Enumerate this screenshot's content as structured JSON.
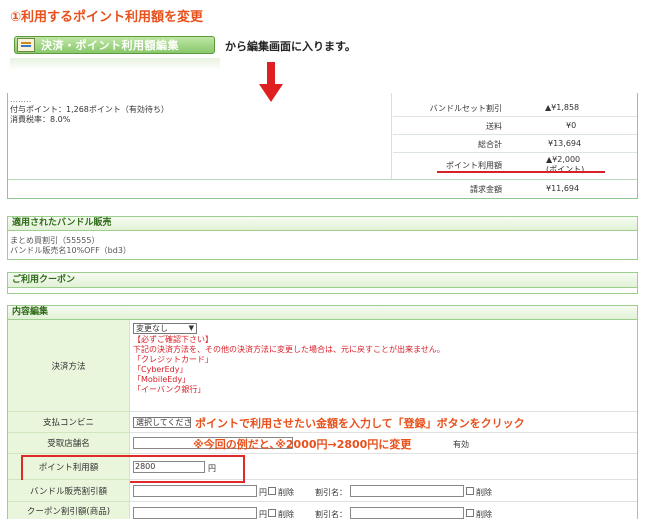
{
  "instructions": {
    "step_title": "①利用するポイント利用額を変更",
    "edit_button_label": "決済・ポイント利用額編集",
    "from_here_note": "から編集画面に入ります。",
    "point_note": "ポイントで利用させたい金額を入力して「登録」ボタンをクリック",
    "example_note": "※今回の例だと､※2000円→2800円に変更"
  },
  "left_info": {
    "line1": "付与ポイント：1,268ポイント（有効待ち）",
    "line2": "消費税率：8.0%"
  },
  "totals": {
    "rows": [
      {
        "label": "バンドルセット割引",
        "value": "▲¥1,858"
      },
      {
        "label": "送料",
        "value": "¥0"
      },
      {
        "label": "総合計",
        "value": "¥13,694"
      },
      {
        "label": "ポイント利用額",
        "value": "▲¥2,000",
        "sub": "(ポイント)"
      },
      {
        "label": "請求金額",
        "value": "¥11,694"
      }
    ]
  },
  "bundle": {
    "title": "適用されたバンドル販売",
    "line1": "まとめ買割引（55555）",
    "line2": "バンドル販売名10%OFF（bd3）"
  },
  "coupon": {
    "title": "ご利用クーポン"
  },
  "edit": {
    "title": "内容編集",
    "payment": {
      "label": "決済方法",
      "select_value": "変更なし",
      "warn_title": "【必ずご確認下さい】",
      "warn_body": "下記の決済方法を、その他の決済方法に変更した場合は、元に戻すことが出来ません。",
      "methods": [
        "「クレジットカード」",
        "「CyberEdy」",
        "「MobileEdy」",
        "「イーバンク銀行」"
      ]
    },
    "convenience": {
      "label": "支払コンビニ",
      "select_value": "選択してくださ"
    },
    "store": {
      "label": "受取店舗名",
      "suffix": "有効"
    },
    "points": {
      "label": "ポイント利用額",
      "value": "2800",
      "unit": "円"
    },
    "bundle_discount": {
      "label": "バンドル販売割引額",
      "unit": "円",
      "delete": "削除",
      "name_label": "割引名：",
      "delete2": "削除"
    },
    "coupon_discount": {
      "label": "クーポン割引額(商品)",
      "unit": "円",
      "delete": "削除",
      "name_label": "割引名：",
      "delete2": "削除"
    }
  },
  "colors": {
    "accent": "#e8501c",
    "highlight_red": "#e02a2a",
    "section_green": "#2f6a18"
  }
}
